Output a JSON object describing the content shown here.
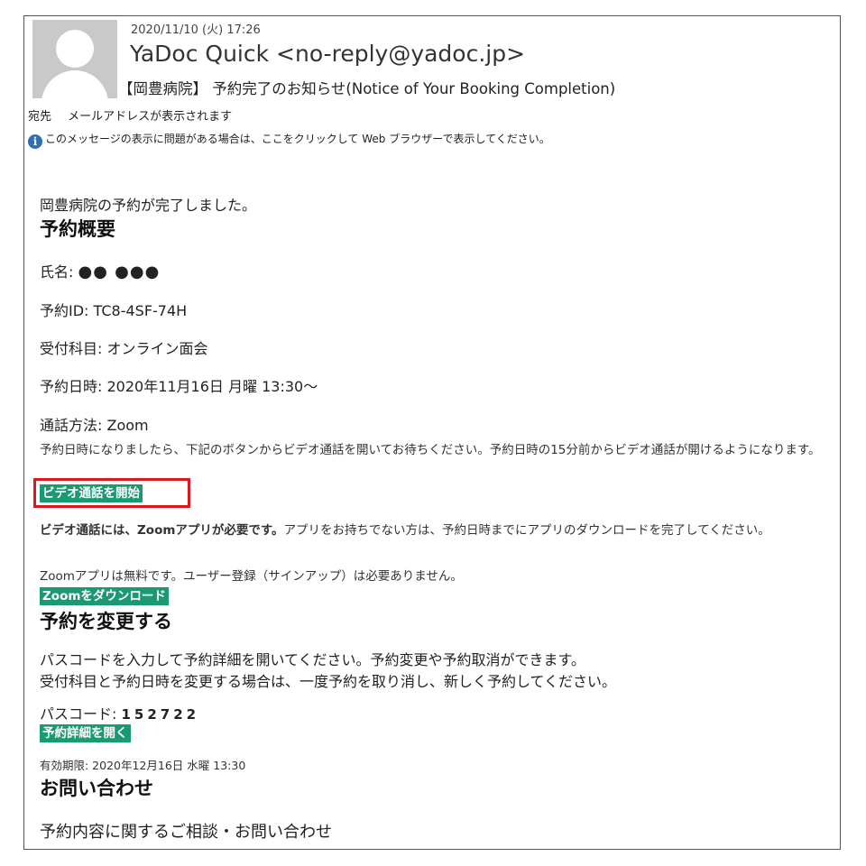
{
  "header": {
    "date": "2020/11/10 (火) 17:26",
    "sender": "YaDoc Quick <no-reply@yadoc.jp>",
    "subject": "【岡豊病院】 予約完了のお知らせ(Notice of Your Booking Completion)",
    "to_label": "宛先",
    "to_value": "メールアドレスが表示されます",
    "info_icon": "info-icon",
    "info_text": "このメッセージの表示に問題がある場合は、ここをクリックして Web ブラウザーで表示してください。"
  },
  "body": {
    "intro": "岡豊病院の予約が完了しました。",
    "summary_title": "予約概要",
    "name_label": "氏名:",
    "name_value": "●● ●●●",
    "id_line": "予約ID: TC8-4SF-74H",
    "dept_line": "受付科目: オンライン面会",
    "datetime_line": "予約日時: 2020年11月16日 月曜 13:30〜",
    "method_line": "通話方法: Zoom",
    "method_note": "予約日時になりましたら、下記のボタンからビデオ通話を開いてお待ちください。予約日時の15分前からビデオ通話が開けるようになります。",
    "video_button": "ビデオ通話を開始",
    "zoom_note_bold": "ビデオ通話には、Zoomアプリが必要です。",
    "zoom_note_rest": "アプリをお持ちでない方は、予約日時までにアプリのダウンロードを完了してください。",
    "zoom_free_note": "Zoomアプリは無料です。ユーザー登録（サインアップ）は必要ありません。",
    "zoom_download_button": "Zoomをダウンロード",
    "change_title": "予約を変更する",
    "change_note_1": "パスコードを入力して予約詳細を開いてください。予約変更や予約取消ができます。",
    "change_note_2": "受付科目と予約日時を変更する場合は、一度予約を取り消し、新しく予約してください。",
    "passcode_label": "パスコード:",
    "passcode_value": "152722",
    "details_button": "予約詳細を開く",
    "expiry": "有効期限: 2020年12月16日 水曜 13:30",
    "contact_title": "お問い合わせ",
    "contact_sub": "予約内容に関するご相談・お問い合わせ"
  },
  "colors": {
    "button_bg": "#1a9a72",
    "highlight_border": "#d71920",
    "info_icon": "#2f6fb4"
  }
}
